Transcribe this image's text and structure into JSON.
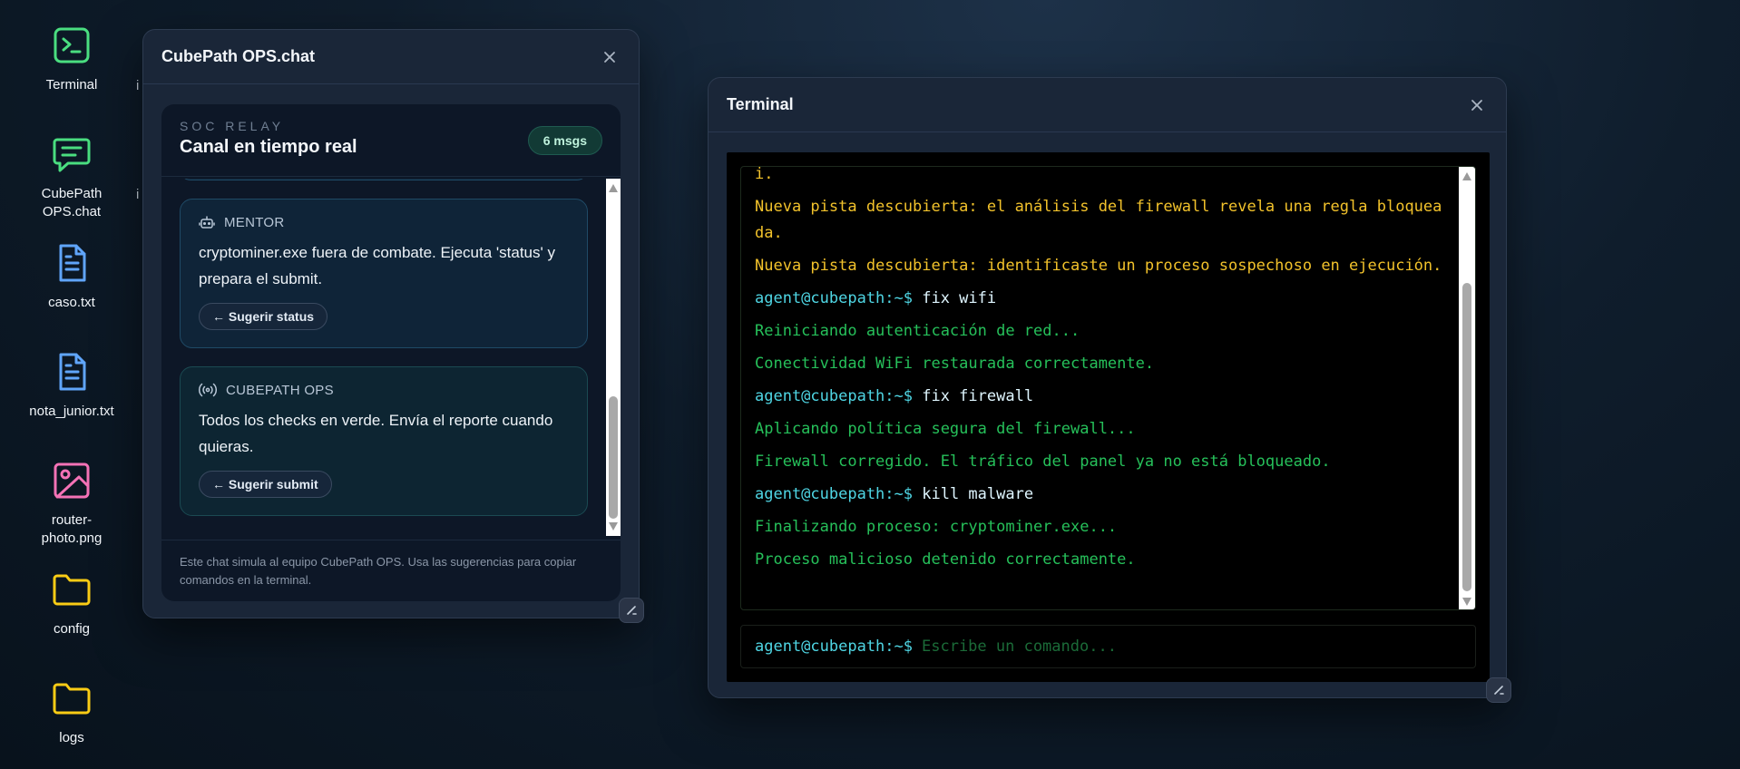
{
  "desktop": {
    "icons": [
      {
        "label": "Terminal",
        "icon": "terminal-icon",
        "color": "#4ade80"
      },
      {
        "label": "CubePath OPS.chat",
        "icon": "chat-icon",
        "color": "#4ade80"
      },
      {
        "label": "caso.txt",
        "icon": "text-file-icon",
        "color": "#60a5fa"
      },
      {
        "label": "nota_junior.txt",
        "icon": "text-file-icon",
        "color": "#60a5fa"
      },
      {
        "label": "router-photo.png",
        "icon": "image-file-icon",
        "color": "#f472b6"
      },
      {
        "label": "config",
        "icon": "folder-icon",
        "color": "#facc15"
      },
      {
        "label": "logs",
        "icon": "folder-icon",
        "color": "#facc15"
      }
    ],
    "peek_labels": [
      "i",
      "i"
    ]
  },
  "chat_window": {
    "title": "CubePath OPS.chat",
    "kicker": "SOC RELAY",
    "heading": "Canal en tiempo real",
    "badge": "6 msgs",
    "messages": [
      {
        "author": "MENTOR",
        "icon": "robot-icon",
        "text": "cryptominer.exe fuera de combate. Ejecuta 'status' y prepara el submit.",
        "suggestion": "← Sugerir status"
      },
      {
        "author": "CUBEPATH OPS",
        "icon": "broadcast-icon",
        "text": "Todos los checks en verde. Envía el reporte cuando quieras.",
        "suggestion": "← Sugerir submit"
      }
    ],
    "footer": "Este chat simula al equipo CubePath OPS. Usa las sugerencias para copiar comandos en la terminal."
  },
  "terminal_window": {
    "title": "Terminal",
    "lines": [
      {
        "text": "i.",
        "color": "yellow"
      },
      {
        "text": "Nueva pista descubierta: el análisis del firewall revela una regla bloqueada.",
        "color": "yellow"
      },
      {
        "text": "Nueva pista descubierta: identificaste un proceso sospechoso en ejecución.",
        "color": "yellow"
      },
      {
        "prompt": "agent@cubepath:~$",
        "text": " fix wifi",
        "color": "cmd"
      },
      {
        "text": "Reiniciando autenticación de red...",
        "color": "green"
      },
      {
        "text": "Conectividad WiFi restaurada correctamente.",
        "color": "green"
      },
      {
        "prompt": "agent@cubepath:~$",
        "text": " fix firewall",
        "color": "cmd"
      },
      {
        "text": "Aplicando política segura del firewall...",
        "color": "green"
      },
      {
        "text": "Firewall corregido. El tráfico del panel ya no está bloqueado.",
        "color": "green"
      },
      {
        "prompt": "agent@cubepath:~$",
        "text": " kill malware",
        "color": "cmd"
      },
      {
        "text": "Finalizando proceso: cryptominer.exe...",
        "color": "green"
      },
      {
        "text": "Proceso malicioso detenido correctamente.",
        "color": "green"
      }
    ],
    "prompt": "agent@cubepath:~$",
    "input_placeholder": "Escribe un comando...",
    "input_value": ""
  },
  "colors": {
    "yellow": "#f2c22b",
    "green": "#26c05a",
    "cyan": "#4fd6e4",
    "accent_green": "#4ade80"
  }
}
